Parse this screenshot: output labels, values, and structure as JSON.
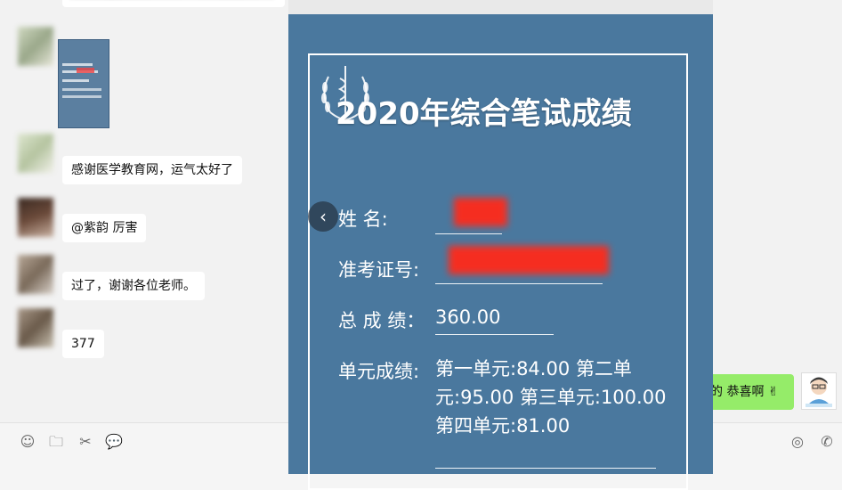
{
  "chat": {
    "messages": [
      {
        "text": "感谢医学教育网，运气太好了"
      },
      {
        "text": "@紫韵 厉害"
      },
      {
        "text": "过了，谢谢各位老师。"
      },
      {
        "text": "377"
      }
    ],
    "right_message": "的 恭喜啊 ✌"
  },
  "score_card": {
    "title": "2020年综合笔试成绩",
    "name_label": "姓     名:",
    "id_label": "准考证号:",
    "total_label": "总 成 绩：",
    "total_value": "360.00",
    "units_label": "单元成绩:",
    "units_value": "第一单元:84.00 第二单元:95.00 第三单元:100.00 第四单元:81.00"
  },
  "viewer": {
    "prev_icon": "‹"
  },
  "toolbar": {
    "emoji_icon": "☺",
    "folder_icon": "🗀",
    "scissors_icon": "✂",
    "chat_icon": "💬",
    "voice_icon": "◎",
    "phone_icon": "✆"
  }
}
